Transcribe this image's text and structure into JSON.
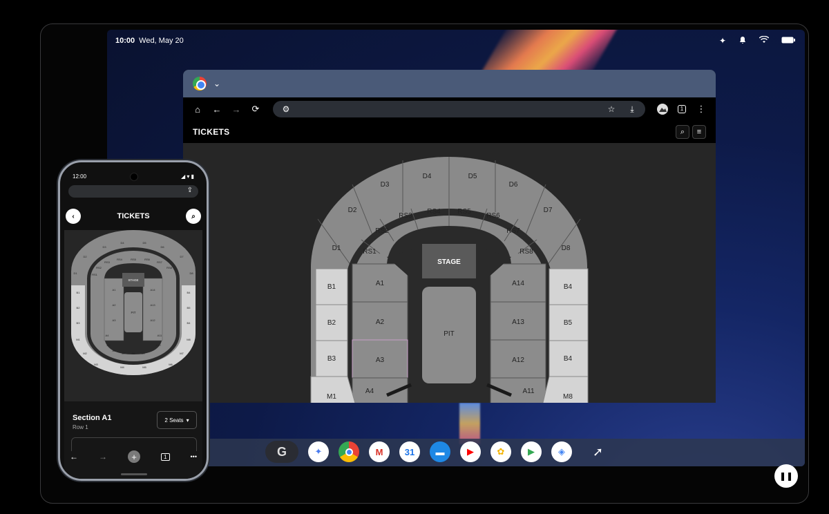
{
  "status_bar": {
    "time": "10:00",
    "date": "Wed, May 20"
  },
  "icons": {
    "sparkle": "✦",
    "bell": "🔔",
    "wifi": "≋",
    "battery": "▭"
  },
  "browser": {
    "page_title": "TICKETS",
    "toolbar": {
      "home": "⌂",
      "back": "←",
      "forward": "→",
      "reload": "⟳",
      "tune": "⚙",
      "star": "☆",
      "download": "⤓",
      "tabs": "1",
      "menu": "⋮"
    },
    "header_icons": {
      "search": "⌕",
      "menu": "≡"
    }
  },
  "seatmap": {
    "stage": "STAGE",
    "pit": "PIT",
    "upper": [
      "D1",
      "D2",
      "D3",
      "D4",
      "D5",
      "D6",
      "D7",
      "D8"
    ],
    "ring": [
      "RS1",
      "RS2",
      "RS3",
      "RS4",
      "RS5",
      "RS6",
      "RS7",
      "RS8"
    ],
    "left_a": [
      "A1",
      "A2",
      "A3",
      "A4"
    ],
    "right_a": [
      "A14",
      "A13",
      "A12",
      "A11"
    ],
    "left_b": [
      "B1",
      "B2",
      "B3"
    ],
    "right_b": [
      "B4",
      "B5",
      "B4"
    ],
    "m_left": "M1",
    "m_right": "M8"
  },
  "phone": {
    "time": "12:00",
    "status_right": "◢ ▾ ▮",
    "title": "TICKETS",
    "back": "‹",
    "search": "⌕",
    "share": "⇪",
    "section": "Section A1",
    "row": "Row 1",
    "seats": "2 Seats",
    "seats_caret": "▾",
    "nav": {
      "back": "←",
      "forward": "→",
      "plus": "+",
      "tabs": "1",
      "more": "•••"
    },
    "map_labels": {
      "stage": "STAGE",
      "pit": "PIT",
      "top": [
        "D3",
        "D4",
        "D5",
        "D6"
      ],
      "d_sides": [
        "D2",
        "D7",
        "D1",
        "D8"
      ],
      "rs": [
        "RS1",
        "RS2",
        "RS3",
        "RS4",
        "RS5",
        "RS6",
        "RS7",
        "RS8"
      ],
      "a_left": [
        "A1",
        "A2",
        "A3",
        "A4"
      ],
      "a_right": [
        "A14",
        "A13",
        "A12",
        "A11"
      ],
      "b_left": [
        "B1",
        "B2",
        "B3"
      ],
      "b_right": [
        "B4",
        "B5",
        "B4"
      ],
      "m_left": [
        "M1",
        "M2",
        "M3"
      ],
      "m_right": [
        "M6",
        "M7",
        "M8"
      ],
      "m_bottom": [
        "M4",
        "M5"
      ],
      "a_bottom": [
        "A5",
        "A6",
        "A7",
        "A8",
        "A9",
        "A10"
      ]
    }
  },
  "dock": {
    "launcher": "G",
    "apps": [
      {
        "name": "gemini",
        "glyph": "✦",
        "bg": "#ffffff",
        "fg": "#4a7cf0"
      },
      {
        "name": "chrome",
        "glyph": "",
        "bg": "conic",
        "fg": "#ffffff"
      },
      {
        "name": "gmail",
        "glyph": "M",
        "bg": "#ffffff",
        "fg": "#d93025"
      },
      {
        "name": "calendar",
        "glyph": "31",
        "bg": "#ffffff",
        "fg": "#1a73e8"
      },
      {
        "name": "files",
        "glyph": "▬",
        "bg": "#1e88e5",
        "fg": "#ffffff"
      },
      {
        "name": "youtube",
        "glyph": "▶",
        "bg": "#ffffff",
        "fg": "#ff0000"
      },
      {
        "name": "photos",
        "glyph": "✿",
        "bg": "#ffffff",
        "fg": "#f4b400"
      },
      {
        "name": "play-store",
        "glyph": "▶",
        "bg": "#ffffff",
        "fg": "#34a853"
      },
      {
        "name": "family-link",
        "glyph": "◈",
        "bg": "#ffffff",
        "fg": "#4285f4"
      }
    ],
    "cursor": "➚",
    "pause": "❚❚"
  }
}
